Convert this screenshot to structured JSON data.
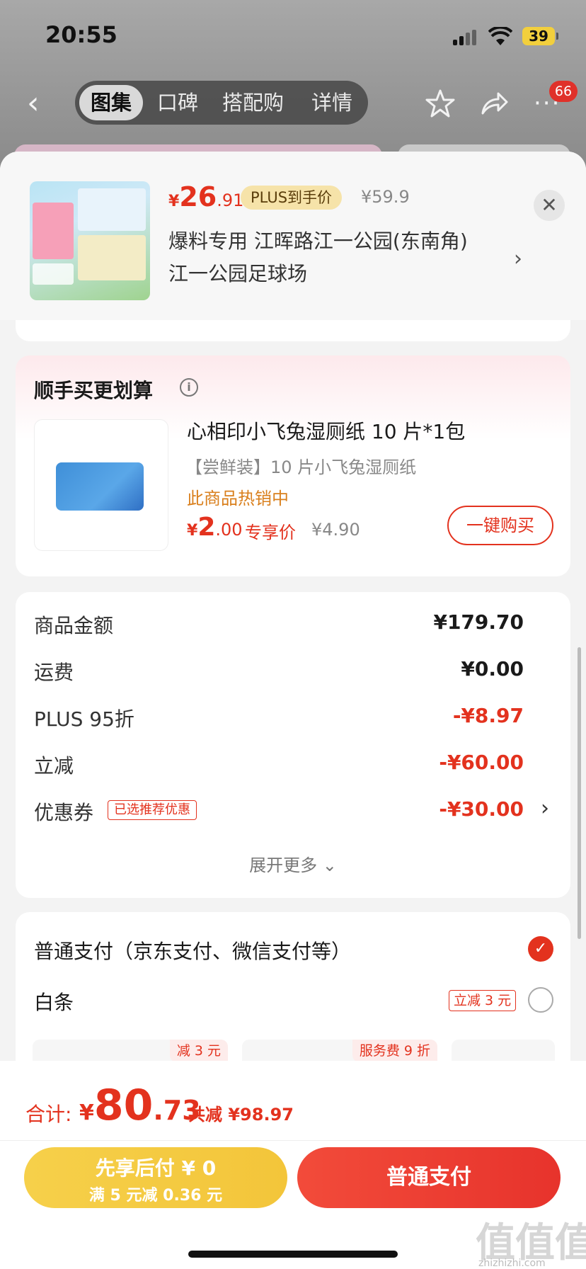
{
  "status_bar": {
    "time": "20:55",
    "battery": "39"
  },
  "nav": {
    "tabs": [
      {
        "label": "图集",
        "active": true
      },
      {
        "label": "口碑",
        "active": false
      },
      {
        "label": "搭配购",
        "active": false
      },
      {
        "label": "详情",
        "active": false
      }
    ],
    "message_badge": "66"
  },
  "product": {
    "price_symbol": "¥",
    "price_int": "26",
    "price_dec": ".91",
    "plus_tag": "PLUS到手价",
    "orig_price": "¥59.9",
    "address_line1": "爆料专用  江晖路江一公园(东南角)",
    "address_line2": "江一公园足球场"
  },
  "bundle": {
    "title": "顺手买更划算",
    "info_glyph": "i",
    "name": "心相印小飞兔湿厕纸 10 片*1包",
    "subtitle": "【尝鲜装】10 片小飞兔湿厕纸",
    "hot": "此商品热销中",
    "price_symbol": "¥",
    "price_int": "2",
    "price_dec": ".00",
    "exclusive": "专享价",
    "orig_price": "¥4.90",
    "buy_label": "一键购买"
  },
  "summary": {
    "rows": [
      {
        "label": "商品金额",
        "value": "¥179.70"
      },
      {
        "label": "运费",
        "value": "¥0.00"
      },
      {
        "label": "PLUS 95折",
        "value": "-¥8.97"
      },
      {
        "label": "立减",
        "value": "-¥60.00"
      },
      {
        "label": "优惠券",
        "value": "-¥30.00",
        "tag": "已选推荐优惠"
      }
    ],
    "expand_label": "展开更多 ⌄"
  },
  "payment": {
    "normal_label": "普通支付（京东支付、微信支付等）",
    "baitiao_label": "白条",
    "baitiao_tag": "立减 3 元",
    "installments": [
      {
        "tag": "减 3 元"
      },
      {
        "tag": "服务费 9 折"
      },
      {
        "tag": ""
      }
    ]
  },
  "bottom": {
    "total_label": "合计:",
    "total_symbol": "¥",
    "total_int": "80",
    "total_dec": ".73",
    "total_saved": "共减 ¥98.97",
    "pay_later_line1": "先享后付 ¥ 0",
    "pay_later_line2": "满 5 元减 0.36 元",
    "pay_normal": "普通支付"
  },
  "watermark": {
    "text": "值值值",
    "url": "zhizhizhi.com"
  },
  "colors": {
    "accent": "#e3321e",
    "gold": "#f3c53a",
    "plus_tag_bg": "#f6e3a9"
  }
}
